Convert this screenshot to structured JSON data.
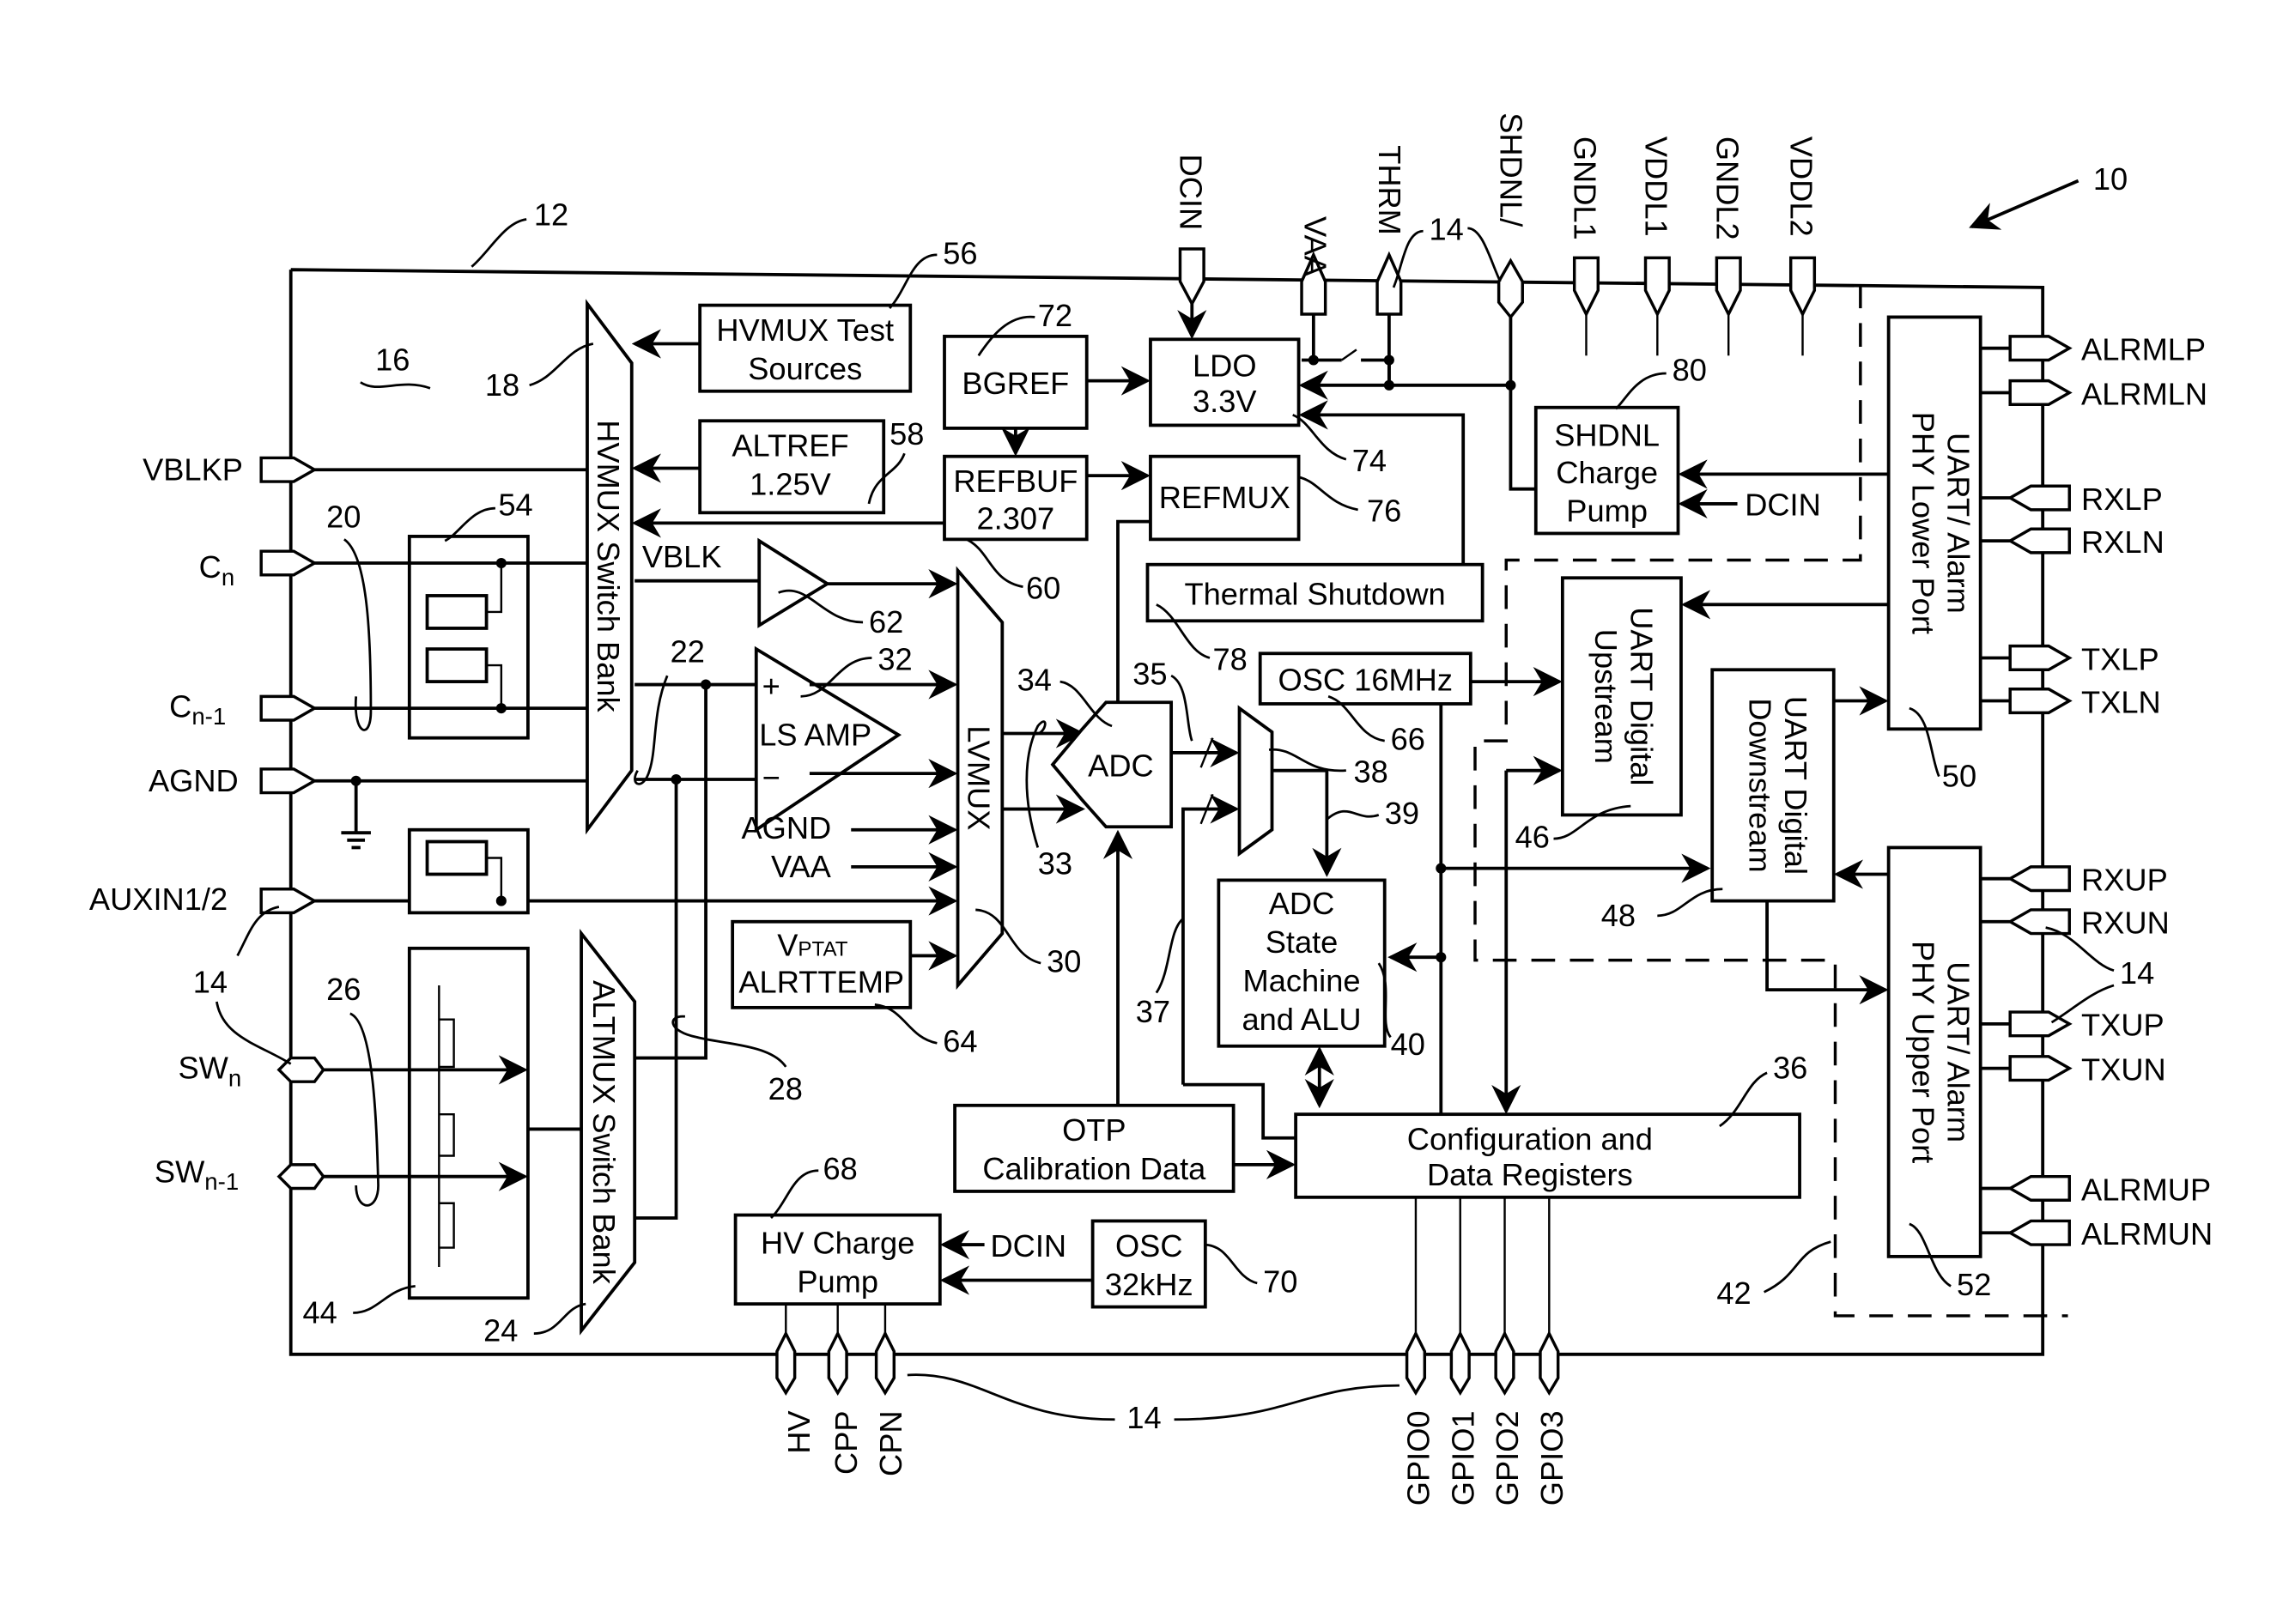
{
  "figure": {
    "reference": "10",
    "chip_ref": "12",
    "die_region_ref": "16"
  },
  "blocks": {
    "hvmux_test": {
      "line1": "HVMUX Test",
      "line2": "Sources",
      "ref": "56"
    },
    "altref": {
      "line1": "ALTREF",
      "line2": "1.25V",
      "ref": "58"
    },
    "bgref": {
      "label": "BGREF",
      "ref": "72"
    },
    "refbuf": {
      "line1": "REFBUF",
      "line2": "2.307",
      "ref": "60"
    },
    "ldo": {
      "line1": "LDO",
      "line2": "3.3V",
      "ref": "74"
    },
    "refmux": {
      "label": "REFMUX",
      "ref": "76"
    },
    "thermal": {
      "label": "Thermal Shutdown",
      "ref": "78"
    },
    "shdnl_cp": {
      "line1": "SHDNL",
      "line2": "Charge",
      "line3": "Pump",
      "ref": "80",
      "input": "DCIN"
    },
    "hvmux": {
      "label": "HVMUX Switch Bank",
      "ref": "18"
    },
    "altmux": {
      "label": "ALTMUX Switch Bank",
      "ref": "24"
    },
    "lvmux": {
      "label": "LVMUX",
      "ref": "30"
    },
    "vblk_buf": {
      "label": "VBLK",
      "ref": "62"
    },
    "ls_amp": {
      "label": "LS AMP",
      "plus": "+",
      "minus": "−",
      "ref": "32"
    },
    "adc": {
      "label": "ADC",
      "ref": "34"
    },
    "osc16": {
      "label": "OSC 16MHz",
      "ref": "66"
    },
    "digmux": {
      "ref": "38"
    },
    "adc_sm": {
      "line1": "ADC",
      "line2": "State",
      "line3": "Machine",
      "line4": "and ALU",
      "ref": "40"
    },
    "vptat": {
      "line1_main": "V",
      "line1_sub": "PTAT",
      "line2": "ALRTTEMP",
      "ref": "64"
    },
    "otp": {
      "line1": "OTP",
      "line2": "Calibration Data"
    },
    "config": {
      "line1": "Configuration and",
      "line2": "Data Registers",
      "ref": "36"
    },
    "hv_cp": {
      "line1": "HV Charge",
      "line2": "Pump",
      "ref": "68",
      "input": "DCIN"
    },
    "osc32": {
      "line1": "OSC",
      "line2": "32kHz",
      "ref": "70"
    },
    "uart_up": {
      "line1": "UART Digital",
      "line2": "Upstream",
      "ref": "46"
    },
    "uart_down": {
      "line1": "UART Digital",
      "line2": "Downstream",
      "ref": "48"
    },
    "phy_lower": {
      "line1": "UART/ Alarm",
      "line2": "PHY Lower Port",
      "ref": "50"
    },
    "phy_upper": {
      "line1": "UART/ Alarm",
      "line2": "PHY Upper Port",
      "ref": "52"
    },
    "cell_balance": {
      "ref": "54"
    },
    "switch_array": {
      "ref": "44"
    },
    "isolation_boundary": {
      "ref": "42"
    }
  },
  "signals": {
    "lvmux_inputs": [
      "AGND",
      "VAA"
    ],
    "refs": {
      "r20": "20",
      "r22": "22",
      "r26": "26",
      "r28": "28",
      "r33": "33",
      "r35": "35",
      "r37": "37",
      "r39": "39",
      "r14": "14"
    }
  },
  "pins": {
    "left": [
      "VBLKP",
      "Cn",
      "Cn-1",
      "AGND",
      "AUXIN1/2",
      "SWn",
      "SWn-1"
    ],
    "left_display": [
      {
        "main": "VBLKP",
        "sub": ""
      },
      {
        "main": "C",
        "sub": "n"
      },
      {
        "main": "C",
        "sub": "n-1"
      },
      {
        "main": "AGND",
        "sub": ""
      },
      {
        "main": "AUXIN1/2",
        "sub": ""
      },
      {
        "main": "SW",
        "sub": "n"
      },
      {
        "main": "SW",
        "sub": "n-1"
      }
    ],
    "top": [
      "DCIN",
      "VAA",
      "THRM",
      "SHDNL/",
      "GNDL1",
      "VDDL1",
      "GNDL2",
      "VDDL2"
    ],
    "right": [
      "ALRMLP",
      "ALRMLN",
      "RXLP",
      "RXLN",
      "TXLP",
      "TXLN",
      "RXUP",
      "RXUN",
      "TXUP",
      "TXUN",
      "ALRMUP",
      "ALRMUN"
    ],
    "bottom": [
      "HV",
      "CPP",
      "CPN",
      "GPIO0",
      "GPIO1",
      "GPIO2",
      "GPIO3"
    ]
  }
}
